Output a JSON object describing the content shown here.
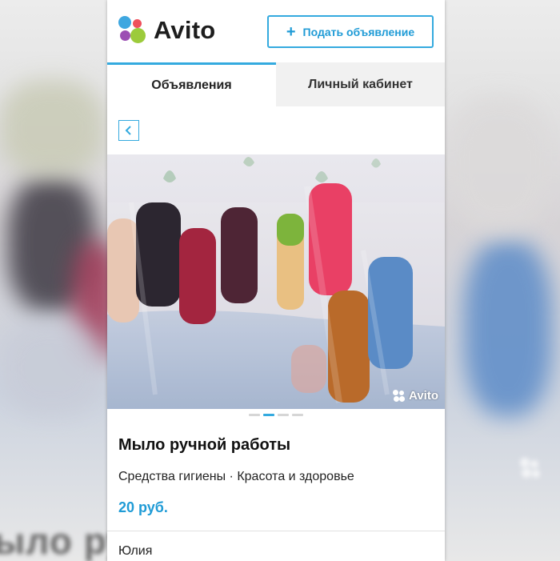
{
  "header": {
    "logo_text": "Avito",
    "post_button_plus": "+",
    "post_button_label": "Подать объявление"
  },
  "tabs": [
    {
      "label": "Объявления",
      "active": true
    },
    {
      "label": "Личный кабинет",
      "active": false
    }
  ],
  "gallery": {
    "watermark": "Avito",
    "pages": 4,
    "current_page": 2
  },
  "listing": {
    "title": "Мыло ручной работы",
    "category": "Средства гигиены · Красота и здоровье",
    "price": "20 руб.",
    "seller": "Юлия"
  },
  "background_text": "ыло ру",
  "colors": {
    "accent": "#34aadf",
    "price": "#1f9bd6",
    "logo_blue": "#3ea7e0",
    "logo_green": "#9ccb3b",
    "logo_red": "#ef4f5b",
    "logo_purple": "#9c4fb3"
  },
  "icons": [
    "avito-logo-icon",
    "plus-icon",
    "back-chevron-icon",
    "avito-watermark-icon"
  ]
}
